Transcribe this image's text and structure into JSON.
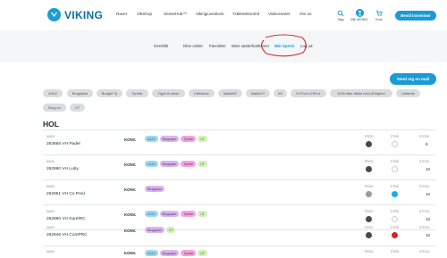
{
  "header": {
    "logo_text": "VIKING",
    "nav": [
      "Racer",
      "VikShop",
      "SenseHub™",
      "VikingLivestock",
      "Ydelseskontrol",
      "Videocenter",
      "Om os"
    ],
    "icons": [
      {
        "label": "Søg",
        "icon": "search-icon"
      },
      {
        "label": "Mit VIKING",
        "icon": "user-icon"
      },
      {
        "label": "Kurv",
        "icon": "cart-icon"
      }
    ],
    "cta_label": "Bestil inseminør"
  },
  "subnav": {
    "items": [
      "Overblik",
      "Dine ordrer",
      "Favoritter",
      "Mine søsterfunktioner",
      "Min Sperm",
      "Log ud"
    ],
    "active_index": 4
  },
  "send_button": "Send mg en mail",
  "filters": [
    "A2A2",
    "Brugsplan",
    "Budget Ty",
    "Tyrefar",
    "Ogsö til rasse",
    "Kælekrav",
    "MalkeBT",
    "MalkeUT",
    "NY",
    "Kr.Prod-CHR-nr",
    "KUN efter aftale med Ældgrind",
    "Uddæde",
    "Brug nu",
    "UT"
  ],
  "section": {
    "title": "HOL",
    "col_name": "NAVN",
    "col_prod": "PROD",
    "col_stra": "STRÅ",
    "col_stock": "STOCK",
    "konv_label": "KONV.",
    "rows": [
      {
        "name": "263588 VH Padel",
        "tags": [
          {
            "text": "A2A2",
            "kind": "blue"
          },
          {
            "text": "Brugsplan",
            "kind": "purple"
          },
          {
            "text": "Tyrefar",
            "kind": "pink"
          },
          {
            "text": "UT",
            "kind": "green"
          }
        ],
        "prod_color": "#4a4a4a",
        "stra_color": "#ffffff",
        "stock": "8"
      },
      {
        "name": "262990 VH Luby",
        "tags": [
          {
            "text": "A2A2",
            "kind": "blue"
          },
          {
            "text": "Brugsplan",
            "kind": "purple"
          },
          {
            "text": "Tyrefar",
            "kind": "pink"
          },
          {
            "text": "UT",
            "kind": "green"
          }
        ],
        "prod_color": "#4a4a4a",
        "stra_color": "#ffffff",
        "stock": "10"
      },
      {
        "name": "262951 VH Co.Pred",
        "tags": [
          {
            "text": "Brugsplan",
            "kind": "purple"
          }
        ],
        "prod_color": "#9a9a9a",
        "stra_color": "#17aee0",
        "stock": "10"
      },
      {
        "name": "262960 VH KarelRC",
        "tags": [
          {
            "text": "A2A2",
            "kind": "blue"
          },
          {
            "text": "Brugsplan",
            "kind": "purple"
          },
          {
            "text": "Tyrefar",
            "kind": "pink"
          },
          {
            "text": "UT",
            "kind": "green"
          }
        ],
        "prod_color": "#4a4a4a",
        "stra_color": "#ffffff",
        "stock": "10"
      },
      {
        "name": "262946 VH ComPRC",
        "tags": [
          {
            "text": "Brugsplan",
            "kind": "purple"
          },
          {
            "text": "UT",
            "kind": "green"
          }
        ],
        "prod_color": "#4a4a4a",
        "stra_color": "#e02020",
        "stock": "10"
      },
      {
        "name": "",
        "tags": [
          {
            "text": "A2A2",
            "kind": "blue"
          },
          {
            "text": "Brugsplan",
            "kind": "purple"
          },
          {
            "text": "Tyrefar",
            "kind": "pink"
          },
          {
            "text": "UT",
            "kind": "green"
          }
        ],
        "prod_color": "#4a4a4a",
        "stra_color": "#ffffff",
        "stock": ""
      }
    ]
  },
  "colors": {
    "accent": "#1a9bd8",
    "highlight_ring": "#d62a2a",
    "tag_blue_bg": "#9fd7f0",
    "tag_purple_bg": "#d8b7ea",
    "tag_pink_bg": "#f2a6e0",
    "tag_green_bg": "#d5efb7"
  }
}
